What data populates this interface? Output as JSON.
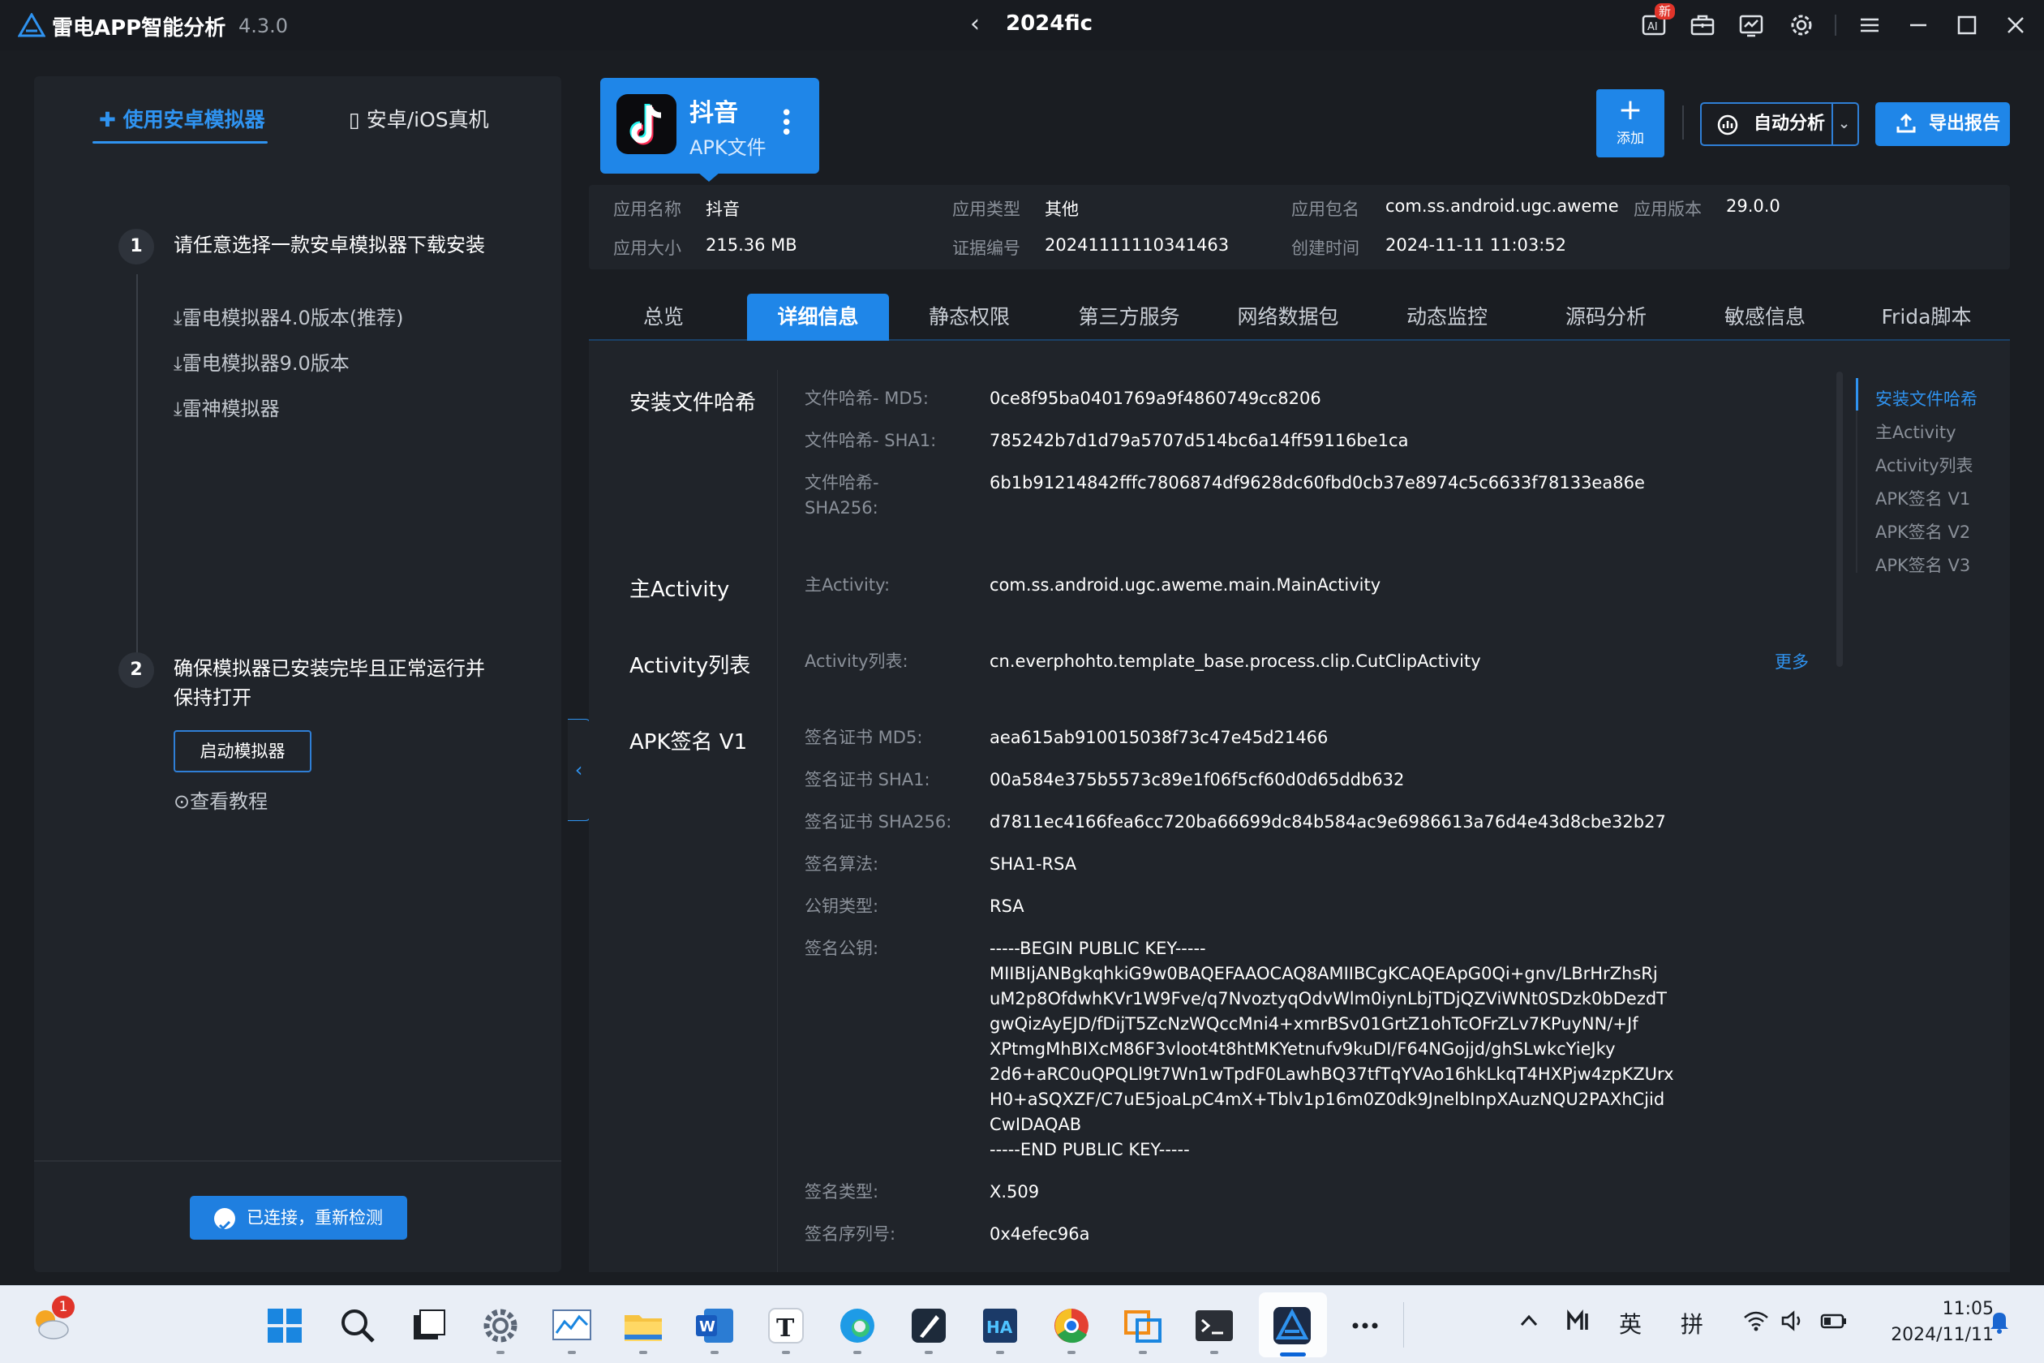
{
  "titlebar": {
    "app_name": "雷电APP智能分析",
    "version": "4.3.0",
    "window_title": "2024fic",
    "badge": "新",
    "icons": [
      "ai-notice-icon",
      "toolbox-icon",
      "monitor-icon",
      "gear-icon",
      "menu-icon",
      "minimize-icon",
      "maximize-icon",
      "close-icon"
    ]
  },
  "left_panel": {
    "mode_tabs": [
      "使用安卓模拟器",
      "安卓/iOS真机"
    ],
    "step1": {
      "num": "1",
      "text": "请任意选择一款安卓模拟器下载安装",
      "links": [
        "雷电模拟器4.0版本(推荐)",
        "雷电模拟器9.0版本",
        "雷神模拟器"
      ]
    },
    "step2": {
      "num": "2",
      "text": "确保模拟器已安装完毕且正常运行并保持打开",
      "start_button": "启动模拟器",
      "tutorial": "查看教程"
    },
    "connect_button": "已连接，重新检测"
  },
  "app_header": {
    "name": "抖音",
    "file_type": "APK文件",
    "add_label": "添加",
    "auto_label": "自动分析",
    "export_label": "导出报告"
  },
  "info": {
    "name_label": "应用名称",
    "name_value": "抖音",
    "type_label": "应用类型",
    "type_value": "其他",
    "package_label": "应用包名",
    "package_value": "com.ss.android.ugc.aweme",
    "version_label": "应用版本",
    "version_value": "29.0.0",
    "size_label": "应用大小",
    "size_value": "215.36 MB",
    "cert_label": "证据编号",
    "cert_value": "20241111110341463",
    "time_label": "创建时间",
    "time_value": "2024-11-11 11:03:52"
  },
  "tabs": [
    "总览",
    "详细信息",
    "静态权限",
    "第三方服务",
    "网络数据包",
    "动态监控",
    "源码分析",
    "敏感信息",
    "Frida脚本"
  ],
  "sections": {
    "hash": {
      "title": "安装文件哈希",
      "md5_label": "文件哈希- MD5:",
      "md5_value": "0ce8f95ba0401769a9f4860749cc8206",
      "sha1_label": "文件哈希- SHA1:",
      "sha1_value": "785242b7d1d79a5707d514bc6a14ff59116be1ca",
      "sha256_label": "文件哈希- SHA256:",
      "sha256_value": "6b1b91214842fffc7806874df9628dc60fbd0cb37e8974c5c6633f78133ea86e"
    },
    "main_activity": {
      "title": "主Activity",
      "label": "主Activity:",
      "value": "com.ss.android.ugc.aweme.main.MainActivity"
    },
    "activity_list": {
      "title": "Activity列表",
      "label": "Activity列表:",
      "value": "cn.everphohto.template_base.process.clip.CutClipActivity",
      "more": "更多"
    },
    "apk_v1": {
      "title": "APK签名 V1",
      "cert_md5_label": "签名证书 MD5:",
      "cert_md5_value": "aea615ab910015038f73c47e45d21466",
      "cert_sha1_label": "签名证书 SHA1:",
      "cert_sha1_value": "00a584e375b5573c89e1f06f5cf60d0d65ddb632",
      "cert_sha256_label": "签名证书 SHA256:",
      "cert_sha256_value": "d7811ec4166fea6cc720ba66699dc84b584ac9e6986613a76d4e43d8cbe32b27",
      "algo_label": "签名算法:",
      "algo_value": "SHA1-RSA",
      "keytype_label": "公钥类型:",
      "keytype_value": "RSA",
      "pubkey_label": "签名公钥:",
      "pubkey_lines": [
        "-----BEGIN PUBLIC KEY-----",
        "MIIBIjANBgkqhkiG9w0BAQEFAAOCAQ8AMIIBCgKCAQEApG0Qi+gnv/LBrHrZhsRj",
        "uM2p8OfdwhKVr1W9Fve/q7NvoztyqOdvWlm0iynLbjTDjQZViWNt0SDzk0bDezdT",
        "gwQizAyEJD/fDijT5ZcNzWQccMni4+xmrBSv01GrtZ1ohTcOFrZLv7KPuyNN/+Jf",
        "XPtmgMhBIXcM86F3vloot4t8htMKYetnufv9kuDI/F64NGojjd/ghSLwkcYieJky",
        "2d6+aRC0uQPQLl9t7Wn1wTpdF0LawhBQ37tfTqYVAo16hkLkqT4HXPjw4zpKZUrx",
        "H0+aSQXZF/C7uE5joaLpC4mX+Tblv1p16m0Z0dk9JnelbInpXAuzNQU2PAXhCjid",
        "CwIDAQAB",
        "-----END PUBLIC KEY-----"
      ],
      "sigtype_label": "签名类型:",
      "sigtype_value": "X.509",
      "serial_label": "签名序列号:",
      "serial_value": "0x4efec96a"
    }
  },
  "anchors": [
    "安装文件哈希",
    "主Activity",
    "Activity列表",
    "APK签名 V1",
    "APK签名 V2",
    "APK签名 V3"
  ],
  "taskbar": {
    "weather_badge": "1",
    "ime_lang": "英",
    "ime_mode": "拼",
    "time": "11:05",
    "date": "2024/11/11"
  }
}
